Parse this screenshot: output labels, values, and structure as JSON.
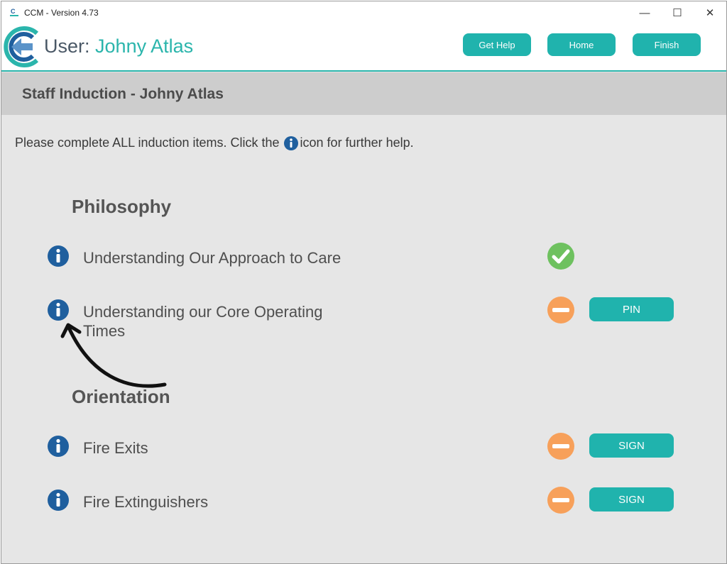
{
  "window": {
    "title": "CCM - Version 4.73",
    "controls": {
      "minimize": "—",
      "maximize": "☐",
      "close": "✕"
    }
  },
  "header": {
    "user_prefix": "User:",
    "user_name": "Johny Atlas",
    "buttons": {
      "get_help": "Get Help",
      "home": "Home",
      "finish": "Finish"
    }
  },
  "banner": {
    "title": "Staff Induction - Johny Atlas"
  },
  "instructions": {
    "before": "Please complete ALL induction items.  Click the",
    "after": "icon for further help."
  },
  "sections": [
    {
      "title": "Philosophy",
      "items": [
        {
          "label": "Understanding Our Approach to Care",
          "status": "complete",
          "action": ""
        },
        {
          "label": "Understanding our Core Operating Times",
          "status": "incomplete",
          "action": "PIN"
        }
      ]
    },
    {
      "title": "Orientation",
      "items": [
        {
          "label": "Fire Exits",
          "status": "incomplete",
          "action": "SIGN"
        },
        {
          "label": "Fire Extinguishers",
          "status": "incomplete",
          "action": "SIGN"
        }
      ]
    }
  ],
  "colors": {
    "accent": "#20b3ad",
    "info_blue": "#1f5f9e",
    "complete_green": "#6ec15f",
    "incomplete_orange": "#f7a05a"
  },
  "icons": {
    "info": "info-icon",
    "complete": "check-circle-icon",
    "incomplete": "minus-circle-icon"
  }
}
